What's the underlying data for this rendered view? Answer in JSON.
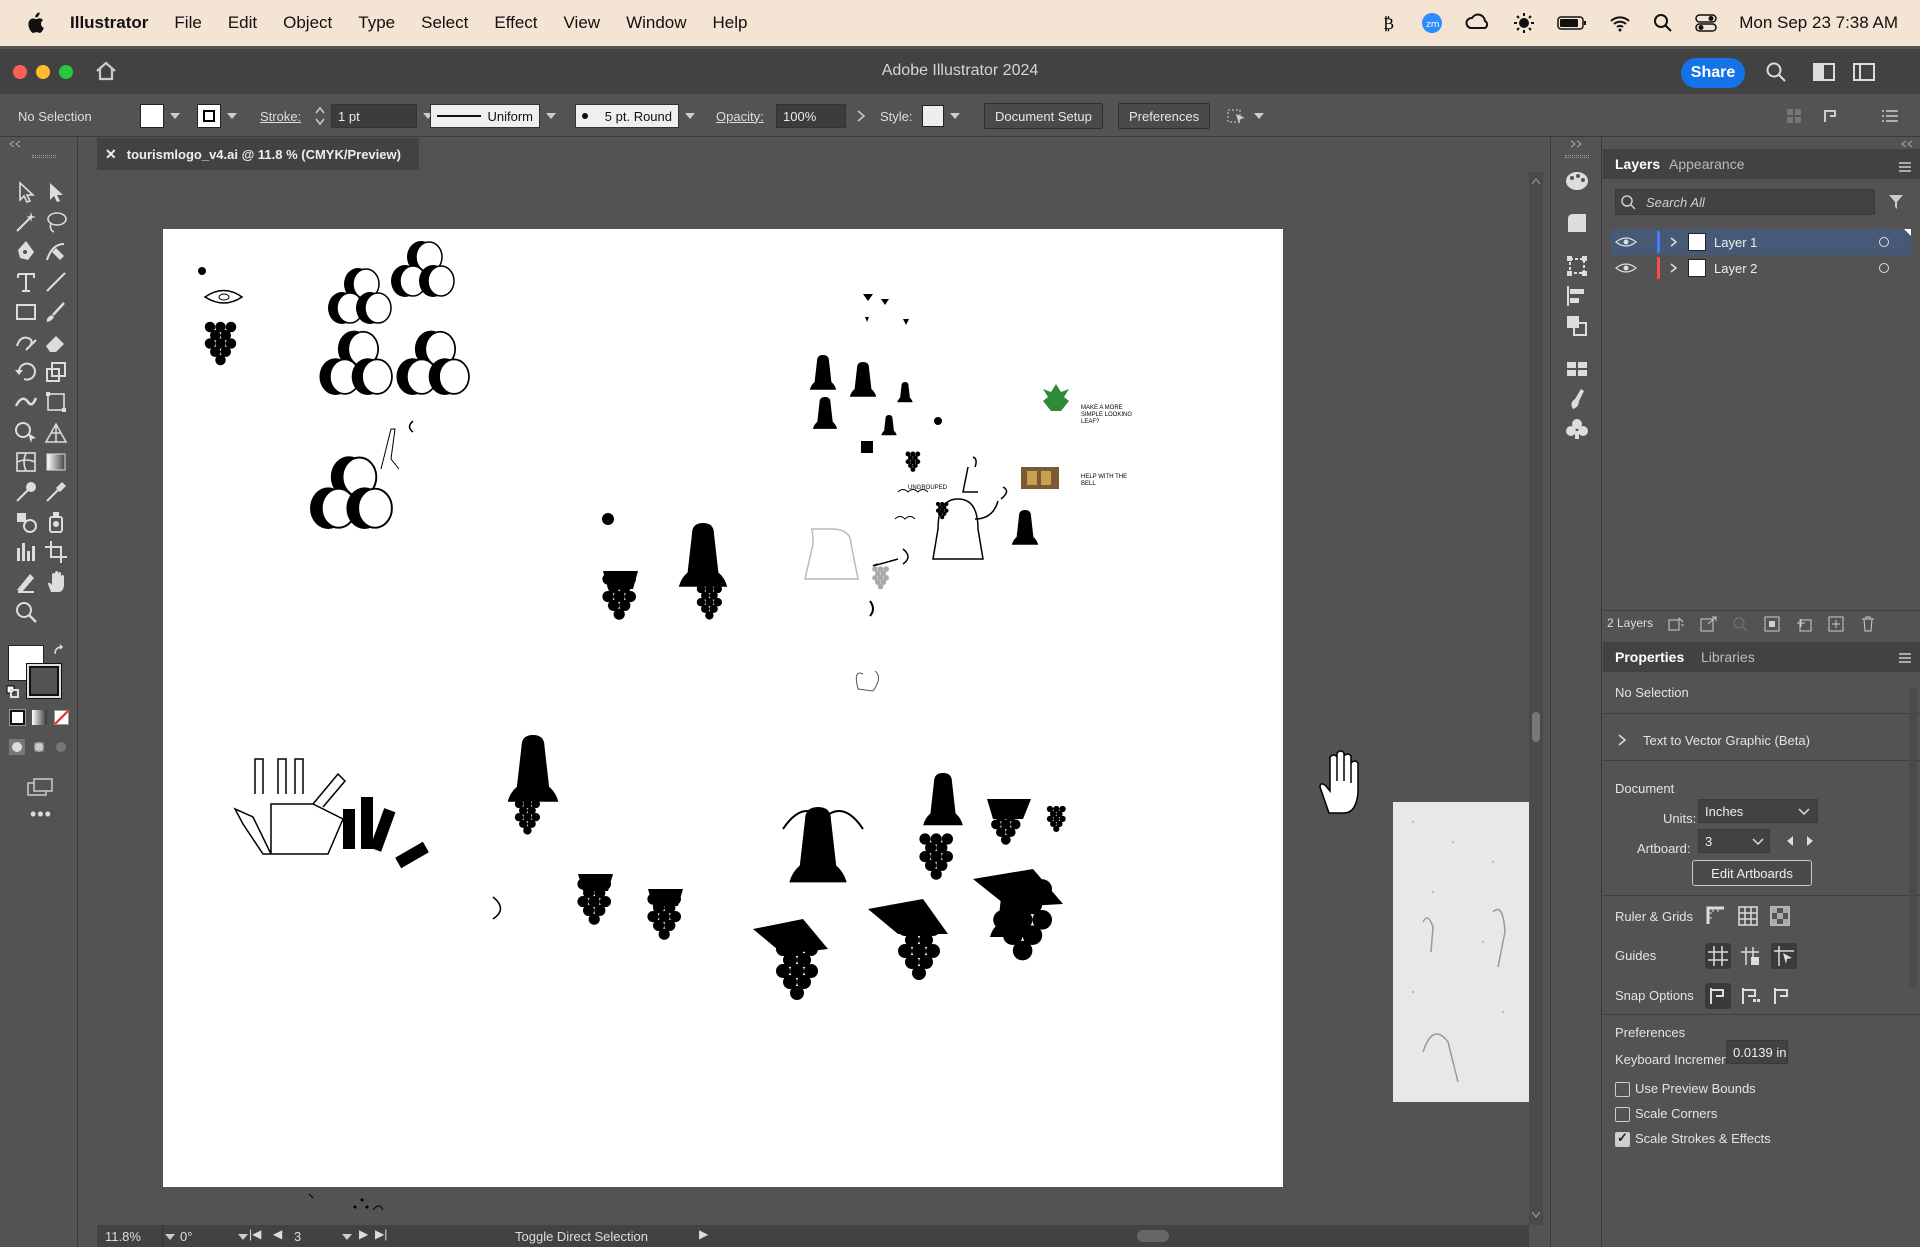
{
  "menubar": {
    "app_name": "Illustrator",
    "items": [
      "File",
      "Edit",
      "Object",
      "Type",
      "Select",
      "Effect",
      "View",
      "Window",
      "Help"
    ],
    "clock": "Mon Sep 23  7:38 AM"
  },
  "titlebar": {
    "title": "Adobe Illustrator 2024",
    "share_label": "Share"
  },
  "controlbar": {
    "selection_status": "No Selection",
    "stroke_label": "Stroke:",
    "stroke_weight": "1 pt",
    "profile": "Uniform",
    "brush": "5 pt. Round",
    "opacity_label": "Opacity:",
    "opacity_value": "100%",
    "style_label": "Style:",
    "document_setup": "Document Setup",
    "preferences": "Preferences"
  },
  "document": {
    "tab_title": "tourismlogo_v4.ai @ 11.8 % (CMYK/Preview)",
    "notes": {
      "leaf_note": "MAKE A MORE SIMPLE LOOKING LEAF?",
      "bell_note": "HELP WITH THE BELL",
      "ungrouped": "UNGROUPED"
    }
  },
  "statusbar": {
    "zoom": "11.8%",
    "rotation": "0°",
    "artboard_num": "3",
    "status_text": "Toggle Direct Selection"
  },
  "layers_panel": {
    "tabs": [
      "Layers",
      "Appearance"
    ],
    "search_placeholder": "Search All",
    "layers": [
      {
        "name": "Layer 1",
        "color": "#4a7bff",
        "selected": true
      },
      {
        "name": "Layer 2",
        "color": "#ff4a4a",
        "selected": false
      }
    ],
    "count": "2 Layers"
  },
  "properties_panel": {
    "tabs": [
      "Properties",
      "Libraries"
    ],
    "status": "No Selection",
    "text_to_vector": "Text to Vector Graphic (Beta)",
    "document_header": "Document",
    "units_label": "Units:",
    "units_value": "Inches",
    "artboard_label": "Artboard:",
    "artboard_value": "3",
    "edit_artboards": "Edit Artboards",
    "ruler_grids": "Ruler & Grids",
    "guides": "Guides",
    "snap_options": "Snap Options",
    "preferences_header": "Preferences",
    "keyboard_increment_label": "Keyboard Increment:",
    "keyboard_increment_value": "0.0139 in",
    "checkboxes": [
      {
        "label": "Use Preview Bounds",
        "checked": false
      },
      {
        "label": "Scale Corners",
        "checked": false
      },
      {
        "label": "Scale Strokes & Effects",
        "checked": true
      }
    ]
  },
  "colors": {
    "accent": "#1473e6",
    "panel_bg": "#535353",
    "menubar_bg": "#f3e4d3"
  }
}
